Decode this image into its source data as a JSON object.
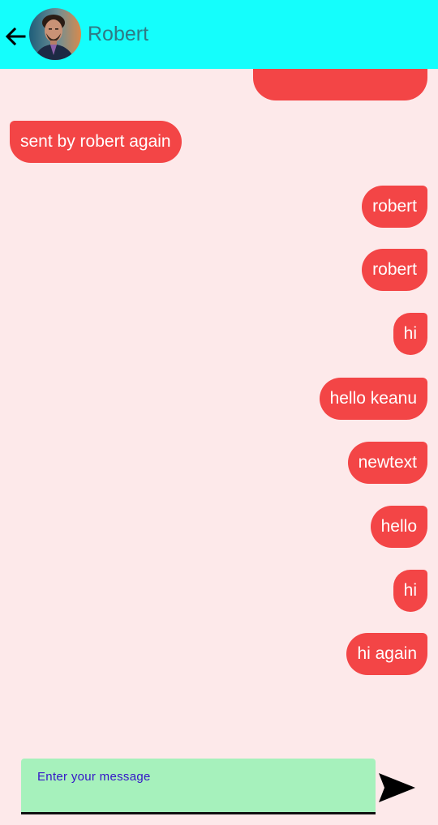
{
  "header": {
    "contact_name": "Robert",
    "back_icon": "arrow-left-icon",
    "background_color": "#14FEFC"
  },
  "messages": [
    {
      "text": "",
      "direction": "sent"
    },
    {
      "text": "sent by robert again",
      "direction": "received"
    },
    {
      "text": "robert",
      "direction": "sent"
    },
    {
      "text": "robert",
      "direction": "sent"
    },
    {
      "text": "hi",
      "direction": "sent"
    },
    {
      "text": "hello keanu",
      "direction": "sent"
    },
    {
      "text": "newtext",
      "direction": "sent"
    },
    {
      "text": "hello",
      "direction": "sent"
    },
    {
      "text": "hi",
      "direction": "sent"
    },
    {
      "text": "hi again",
      "direction": "sent"
    }
  ],
  "composer": {
    "placeholder": "Enter your message",
    "send_icon": "send-icon"
  },
  "colors": {
    "background": "#FDE9EA",
    "bubble": "#F34546",
    "input_background": "#A6F1BC",
    "placeholder_text": "#3414C8"
  }
}
